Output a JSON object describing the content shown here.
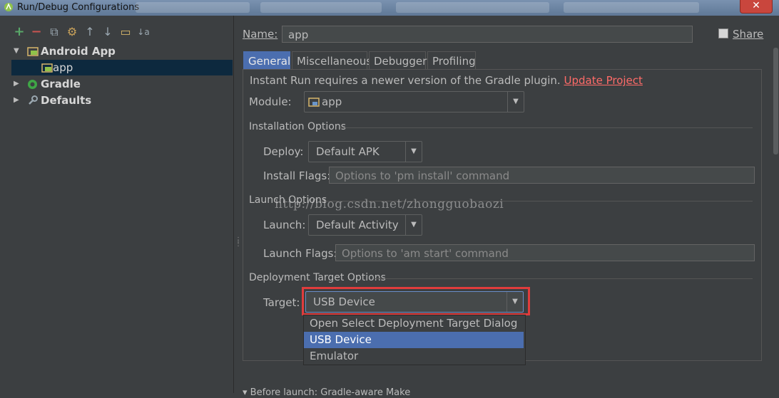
{
  "window": {
    "title": "Run/Debug Configurations",
    "close_label": "✕"
  },
  "toolbar": {
    "add": "+",
    "remove": "−",
    "copy": "⧉",
    "edit": "⚙",
    "up": "↑",
    "down": "↓",
    "folder": "▭",
    "sort": "↓a"
  },
  "tree": {
    "android_app": "Android App",
    "app": "app",
    "gradle": "Gradle",
    "defaults": "Defaults"
  },
  "config": {
    "name_label": "Name:",
    "name_value": "app",
    "share_label": "Share"
  },
  "tabs": [
    "General",
    "Miscellaneous",
    "Debugger",
    "Profiling"
  ],
  "general": {
    "notice": "Instant Run requires a newer version of the Gradle plugin.",
    "notice_link": "Update Project",
    "module_label": "Module:",
    "module_value": "app",
    "installation_section": "Installation Options",
    "deploy_label": "Deploy:",
    "deploy_value": "Default APK",
    "install_flags_label": "Install Flags:",
    "install_flags_placeholder": "Options to 'pm install' command",
    "launch_section": "Launch Options",
    "launch_label": "Launch:",
    "launch_value": "Default Activity",
    "launch_flags_label": "Launch Flags:",
    "launch_flags_placeholder": "Options to 'am start' command",
    "deployment_section": "Deployment Target Options",
    "target_label": "Target:",
    "target_value": "USB Device",
    "target_options": [
      "Open Select Deployment Target Dialog",
      "USB Device",
      "Emulator"
    ],
    "before_launch": "Before launch: Gradle-aware Make"
  },
  "watermark": "http://blog.csdn.net/zhongguobaozi",
  "colors": {
    "selection": "#4b6eaf",
    "highlight_box": "#e03c3c",
    "link": "#ff6b68",
    "gradle_green": "#3fa646",
    "add_green": "#59a869",
    "remove_red": "#c75450"
  }
}
